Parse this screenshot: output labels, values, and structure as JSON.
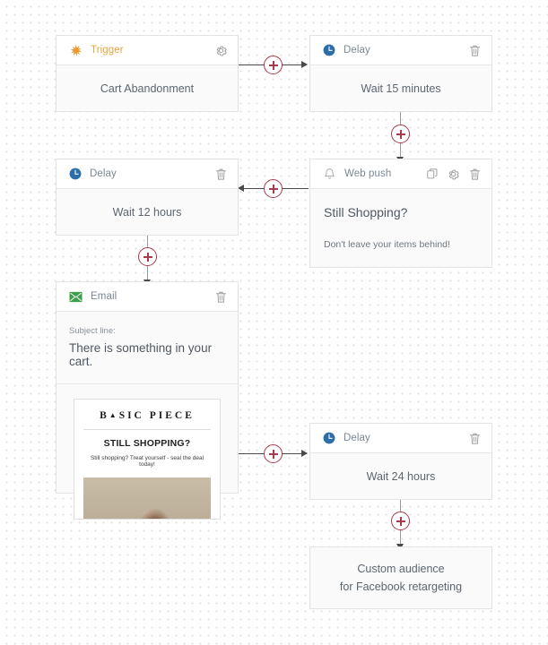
{
  "canvas": {
    "background_color": "#ffffff",
    "dot_color": "#e2dede",
    "connector_color": "#4a4a4a",
    "plus_color": "#a83a4b"
  },
  "nodes": {
    "trigger": {
      "type_label": "Trigger",
      "icon": "sparkle-icon",
      "accent_color": "#e8a33d",
      "body_text": "Cart Abandonment",
      "actions": [
        "gear-icon"
      ]
    },
    "delay_1": {
      "type_label": "Delay",
      "icon": "clock-icon",
      "accent_color": "#2c6ea8",
      "body_text": "Wait 15 minutes",
      "actions": [
        "trash-icon"
      ]
    },
    "web_push": {
      "type_label": "Web push",
      "icon": "bell-icon",
      "title": "Still Shopping?",
      "message": "Don't leave your items behind!",
      "actions": [
        "copy-icon",
        "gear-icon",
        "trash-icon"
      ]
    },
    "delay_2": {
      "type_label": "Delay",
      "icon": "clock-icon",
      "accent_color": "#2c6ea8",
      "body_text": "Wait 12 hours",
      "actions": [
        "trash-icon"
      ]
    },
    "email": {
      "type_label": "Email",
      "icon": "envelope-icon",
      "accent_color": "#3c9f4a",
      "subject_label": "Subject line:",
      "subject_value": "There is something in your cart.",
      "actions": [
        "trash-icon"
      ],
      "preview": {
        "brand_left": "B",
        "brand_mark": "▲",
        "brand_right": "SIC PIECE",
        "headline": "STILL SHOPPING?",
        "subtext": "Still shopping? Treat yourself - seal the deal today!"
      }
    },
    "delay_3": {
      "type_label": "Delay",
      "icon": "clock-icon",
      "accent_color": "#2c6ea8",
      "body_text": "Wait 24 hours",
      "actions": [
        "trash-icon"
      ]
    },
    "custom_audience": {
      "body_line_1": "Custom audience",
      "body_line_2": "for Facebook retargeting"
    }
  }
}
